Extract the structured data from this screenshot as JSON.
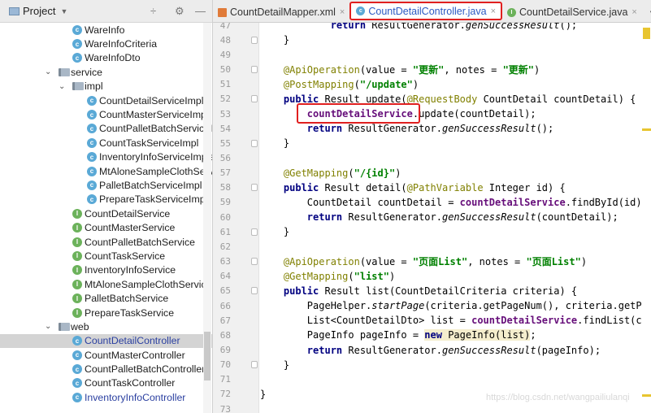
{
  "project_panel": {
    "title": "Project",
    "tools": [
      "÷",
      "⚙",
      "—"
    ]
  },
  "tree": [
    {
      "label": "WareInfo",
      "icon": "c",
      "level": 3
    },
    {
      "label": "WareInfoCriteria",
      "icon": "c",
      "level": 3
    },
    {
      "label": "WareInfoDto",
      "icon": "c",
      "level": 3
    },
    {
      "label": "service",
      "icon": "folder",
      "level": 1,
      "expanded": true
    },
    {
      "label": "impl",
      "icon": "folder",
      "level": 2,
      "expanded": true
    },
    {
      "label": "CountDetailServiceImpl",
      "icon": "c",
      "level": 4
    },
    {
      "label": "CountMasterServiceImpl",
      "icon": "c",
      "level": 4
    },
    {
      "label": "CountPalletBatchServiceIm",
      "icon": "c",
      "level": 4
    },
    {
      "label": "CountTaskServiceImpl",
      "icon": "c",
      "level": 4
    },
    {
      "label": "InventoryInfoServiceImple",
      "icon": "c",
      "level": 4
    },
    {
      "label": "MtAloneSampleClothServi",
      "icon": "c",
      "level": 4
    },
    {
      "label": "PalletBatchServiceImpl",
      "icon": "c",
      "level": 4
    },
    {
      "label": "PrepareTaskServiceImpl",
      "icon": "c",
      "level": 4
    },
    {
      "label": "CountDetailService",
      "icon": "i",
      "level": 3
    },
    {
      "label": "CountMasterService",
      "icon": "i",
      "level": 3
    },
    {
      "label": "CountPalletBatchService",
      "icon": "i",
      "level": 3
    },
    {
      "label": "CountTaskService",
      "icon": "i",
      "level": 3
    },
    {
      "label": "InventoryInfoService",
      "icon": "i",
      "level": 3
    },
    {
      "label": "MtAloneSampleClothService",
      "icon": "i",
      "level": 3
    },
    {
      "label": "PalletBatchService",
      "icon": "i",
      "level": 3
    },
    {
      "label": "PrepareTaskService",
      "icon": "i",
      "level": 3
    },
    {
      "label": "web",
      "icon": "folder",
      "level": 1,
      "expanded": true
    },
    {
      "label": "CountDetailController",
      "icon": "c",
      "level": 3,
      "selected": true,
      "color": "#2a3fa0"
    },
    {
      "label": "CountMasterController",
      "icon": "c",
      "level": 3
    },
    {
      "label": "CountPalletBatchController",
      "icon": "c",
      "level": 3
    },
    {
      "label": "CountTaskController",
      "icon": "c",
      "level": 3
    },
    {
      "label": "InventoryInfoController",
      "icon": "c",
      "level": 3,
      "color": "#2a3fa0"
    }
  ],
  "tabs": [
    {
      "label": "CountDetailMapper.xml",
      "icon": "xml",
      "active": false
    },
    {
      "label": "CountDetailController.java",
      "icon": "c",
      "active": true
    },
    {
      "label": "CountDetailService.java",
      "icon": "i",
      "active": false
    }
  ],
  "tabs_overflow": "▾≡",
  "code_lines": [
    {
      "n": "47",
      "fold": false,
      "tokens": [
        [
          "",
          "            "
        ],
        [
          "kw",
          "return"
        ],
        [
          "",
          " ResultGenerator."
        ],
        [
          "it",
          "genSuccessResult"
        ],
        [
          "",
          "();"
        ]
      ]
    },
    {
      "n": "48",
      "fold": true,
      "tokens": [
        [
          "",
          "    }"
        ]
      ]
    },
    {
      "n": "49",
      "fold": false,
      "tokens": []
    },
    {
      "n": "50",
      "fold": true,
      "tokens": [
        [
          "",
          "    "
        ],
        [
          "ann",
          "@ApiOperation"
        ],
        [
          "",
          "(value = "
        ],
        [
          "str",
          "\"更新\""
        ],
        [
          "",
          ", notes = "
        ],
        [
          "str",
          "\"更新\""
        ],
        [
          "",
          ")"
        ]
      ]
    },
    {
      "n": "51",
      "fold": false,
      "tokens": [
        [
          "",
          "    "
        ],
        [
          "ann",
          "@PostMapping"
        ],
        [
          "",
          "("
        ],
        [
          "str",
          "\"/update\""
        ],
        [
          "",
          ")"
        ]
      ]
    },
    {
      "n": "52",
      "fold": true,
      "tokens": [
        [
          "",
          "    "
        ],
        [
          "kw",
          "public"
        ],
        [
          "",
          " Result update("
        ],
        [
          "ann",
          "@RequestBody"
        ],
        [
          "",
          " CountDetail countDetail) {"
        ]
      ]
    },
    {
      "n": "53",
      "fold": false,
      "tokens": [
        [
          "",
          "        "
        ],
        [
          "fld",
          "countDetailService"
        ],
        [
          "",
          ".update(countDetail);"
        ]
      ]
    },
    {
      "n": "54",
      "fold": false,
      "tokens": [
        [
          "",
          "        "
        ],
        [
          "kw",
          "return"
        ],
        [
          "",
          " ResultGenerator."
        ],
        [
          "it",
          "genSuccessResult"
        ],
        [
          "",
          "();"
        ]
      ]
    },
    {
      "n": "55",
      "fold": true,
      "tokens": [
        [
          "",
          "    }"
        ]
      ]
    },
    {
      "n": "56",
      "fold": false,
      "tokens": []
    },
    {
      "n": "57",
      "fold": false,
      "tokens": [
        [
          "",
          "    "
        ],
        [
          "ann",
          "@GetMapping"
        ],
        [
          "",
          "("
        ],
        [
          "str",
          "\"/{id}\""
        ],
        [
          "",
          ")"
        ]
      ]
    },
    {
      "n": "58",
      "fold": true,
      "tokens": [
        [
          "",
          "    "
        ],
        [
          "kw",
          "public"
        ],
        [
          "",
          " Result detail("
        ],
        [
          "ann",
          "@PathVariable"
        ],
        [
          "",
          " Integer id) {"
        ]
      ]
    },
    {
      "n": "59",
      "fold": false,
      "tokens": [
        [
          "",
          "        CountDetail countDetail = "
        ],
        [
          "fld",
          "countDetailService"
        ],
        [
          "",
          ".findById(id);"
        ]
      ]
    },
    {
      "n": "60",
      "fold": false,
      "tokens": [
        [
          "",
          "        "
        ],
        [
          "kw",
          "return"
        ],
        [
          "",
          " ResultGenerator."
        ],
        [
          "it",
          "genSuccessResult"
        ],
        [
          "",
          "(countDetail);"
        ]
      ]
    },
    {
      "n": "61",
      "fold": true,
      "tokens": [
        [
          "",
          "    }"
        ]
      ]
    },
    {
      "n": "62",
      "fold": false,
      "tokens": []
    },
    {
      "n": "63",
      "fold": true,
      "tokens": [
        [
          "",
          "    "
        ],
        [
          "ann",
          "@ApiOperation"
        ],
        [
          "",
          "(value = "
        ],
        [
          "str",
          "\"页面List\""
        ],
        [
          "",
          ", notes = "
        ],
        [
          "str",
          "\"页面List\""
        ],
        [
          "",
          ")"
        ]
      ]
    },
    {
      "n": "64",
      "fold": false,
      "tokens": [
        [
          "",
          "    "
        ],
        [
          "ann",
          "@GetMapping"
        ],
        [
          "",
          "("
        ],
        [
          "str",
          "\"list\""
        ],
        [
          "",
          ")"
        ]
      ]
    },
    {
      "n": "65",
      "fold": true,
      "tokens": [
        [
          "",
          "    "
        ],
        [
          "kw",
          "public"
        ],
        [
          "",
          " Result list(CountDetailCriteria criteria) {"
        ]
      ]
    },
    {
      "n": "66",
      "fold": false,
      "tokens": [
        [
          "",
          "        PageHelper."
        ],
        [
          "it",
          "startPage"
        ],
        [
          "",
          "(criteria.getPageNum(), criteria.getPag"
        ]
      ]
    },
    {
      "n": "67",
      "fold": false,
      "tokens": [
        [
          "",
          "        List<CountDetailDto> list = "
        ],
        [
          "fld",
          "countDetailService"
        ],
        [
          "",
          ".findList(cr"
        ]
      ]
    },
    {
      "n": "68",
      "fold": false,
      "tokens": [
        [
          "",
          "        PageInfo pageInfo = "
        ],
        [
          "kw hl",
          "new"
        ],
        [
          "hl",
          " PageInfo(list)"
        ],
        [
          "",
          ";"
        ]
      ]
    },
    {
      "n": "69",
      "fold": false,
      "tokens": [
        [
          "",
          "        "
        ],
        [
          "kw",
          "return"
        ],
        [
          "",
          " ResultGenerator."
        ],
        [
          "it",
          "genSuccessResult"
        ],
        [
          "",
          "(pageInfo);"
        ]
      ]
    },
    {
      "n": "70",
      "fold": true,
      "tokens": [
        [
          "",
          "    }"
        ]
      ]
    },
    {
      "n": "71",
      "fold": false,
      "tokens": []
    },
    {
      "n": "72",
      "fold": false,
      "tokens": [
        [
          "",
          "}"
        ]
      ]
    },
    {
      "n": "73",
      "fold": false,
      "tokens": []
    }
  ],
  "watermark": "https://blog.csdn.net/wangpailiulanqi"
}
